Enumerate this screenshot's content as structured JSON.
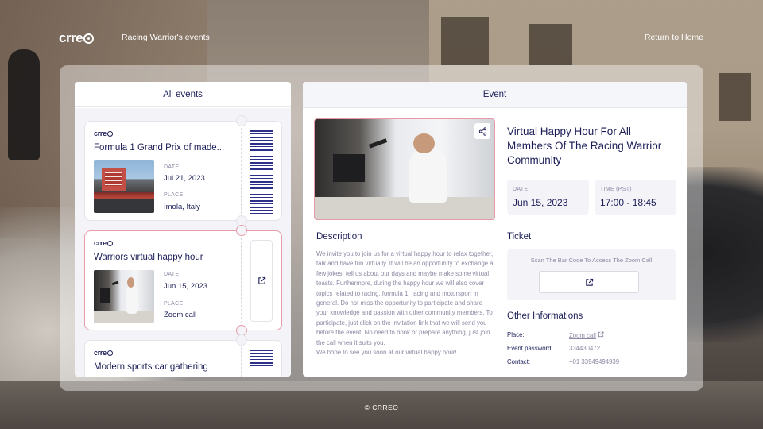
{
  "header": {
    "logo_text": "crre",
    "app_title": "Racing Warrior's events",
    "home_link": "Return to Home"
  },
  "events_panel": {
    "title": "All events",
    "items": [
      {
        "logo": "crre",
        "title": "Formula 1 Grand Prix of made...",
        "date_label": "DATE",
        "date": "Jul 21, 2023",
        "place_label": "PLACE",
        "place": "Imola, Italy",
        "right_icon": "barcode-icon",
        "selected": false
      },
      {
        "logo": "crre",
        "title": "Warriors virtual happy hour",
        "date_label": "DATE",
        "date": "Jun 15, 2023",
        "place_label": "PLACE",
        "place": "Zoom call",
        "right_icon": "external-link-icon",
        "selected": true
      },
      {
        "logo": "crre",
        "title": "Modern sports car gathering",
        "right_icon": "barcode-icon",
        "selected": false
      }
    ]
  },
  "event_panel": {
    "title": "Event",
    "event_title": "Virtual Happy Hour For All Members Of The Racing Warrior Community",
    "date_label": "DATE",
    "date": "Jun 15, 2023",
    "time_label": "TIME (PST)",
    "time": "17:00 - 18:45",
    "description_title": "Description",
    "description": "We invite you to join us for a virtual happy hour to relax together, talk and have fun virtually. It will be an opportunity to exchange a few jokes, tell us about our days and maybe make some virtual toasts. Furthermore, during the happy hour we will also cover topics related to racing, formula 1, racing and motorsport in general. Do not miss the opportunity to participate and share your knowledge and passion with other community members. To participate, just click on the invitation link that we will send you before the event. No need to book or prepare anything, just join the call when it suits you.",
    "description_closing": "We hope to see you soon at our virtual happy hour!",
    "ticket_title": "Ticket",
    "ticket_hint": "Scan The Bar Code To Access The Zoom Call",
    "other_title": "Other Informations",
    "other_rows": [
      {
        "label": "Place:",
        "value": "Zoom call"
      },
      {
        "label": "Event password:",
        "value": "334430472"
      },
      {
        "label": "Contact:",
        "value": "+01 33949494939"
      }
    ]
  },
  "footer": {
    "text": "© CRREO"
  },
  "colors": {
    "navy": "#1b1d57",
    "muted": "#8a8aa3",
    "accent_pink": "#e79aa8",
    "barcode": "#2c2f8a"
  }
}
